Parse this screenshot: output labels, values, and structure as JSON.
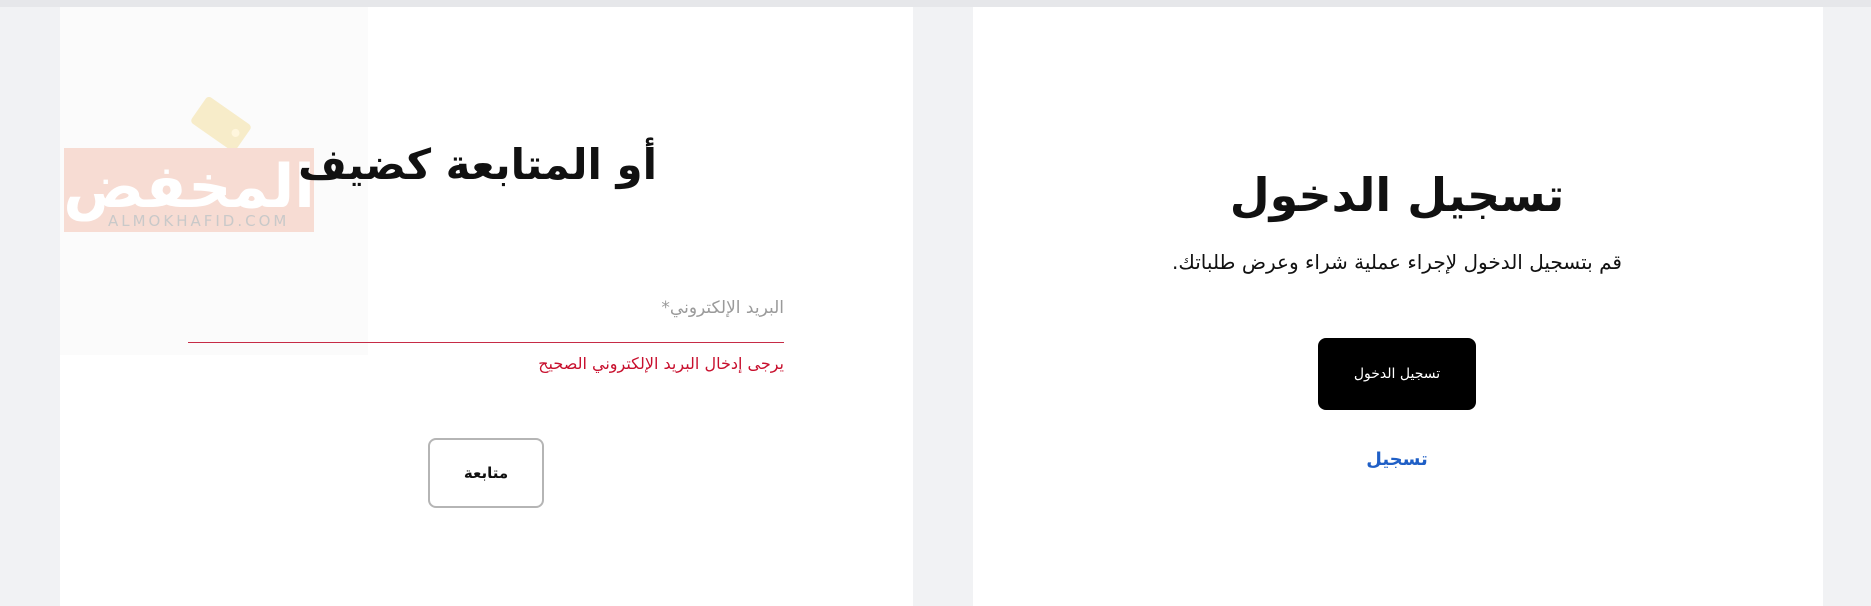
{
  "guest": {
    "title": "أو المتابعة كضيف",
    "email_label": "البريد الإلكتروني*",
    "email_value": "",
    "email_error": "يرجى إدخال البريد الإلكتروني الصحيح",
    "continue_label": "متابعة"
  },
  "login": {
    "title": "تسجيل الدخول",
    "subtitle": "قم بتسجيل الدخول لإجراء عملية شراء وعرض طلباتك.",
    "login_button": "تسجيل الدخول",
    "register_link": "تسجيل"
  },
  "watermark": {
    "logo_text": "المخفض",
    "domain": "ALMOKHAFID.COM"
  },
  "colors": {
    "error": "#c8102e",
    "link": "#1f5fc6",
    "primary_button": "#000000"
  }
}
